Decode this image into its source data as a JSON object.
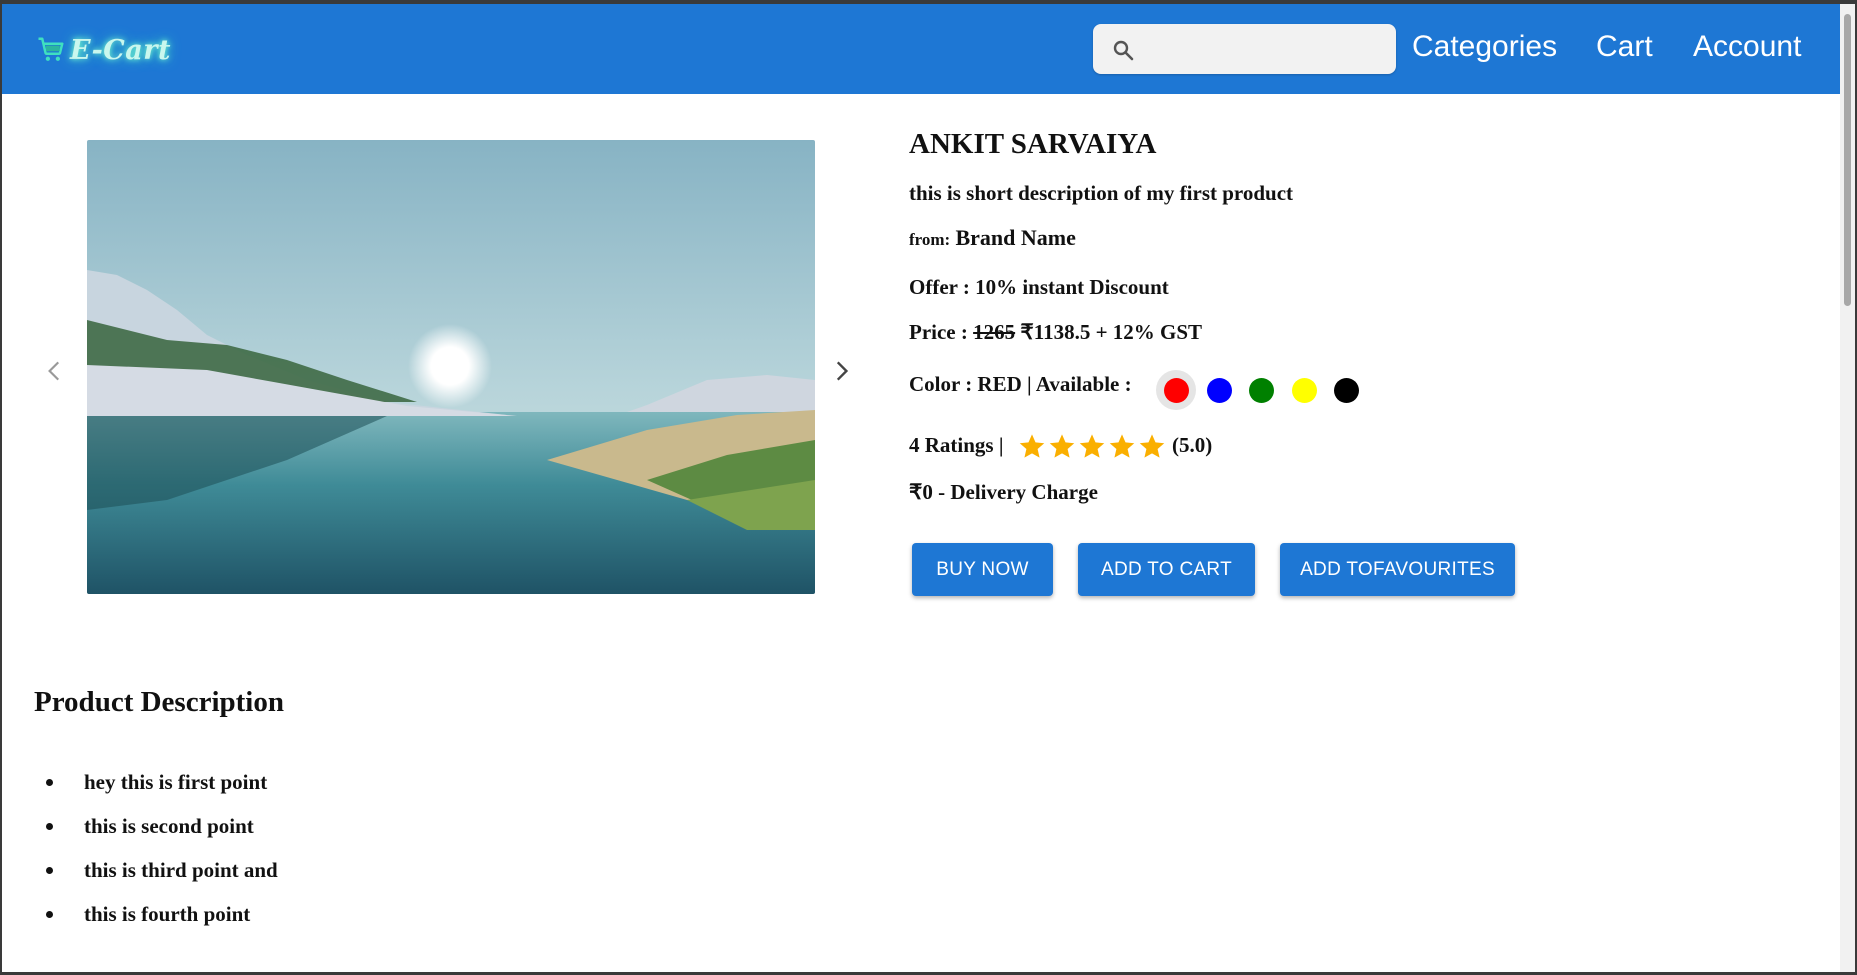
{
  "header": {
    "logo_text": "E-Cart",
    "search": {
      "value": "",
      "placeholder": ""
    },
    "nav": {
      "categories": "Categories",
      "cart": "Cart",
      "account": "Account"
    }
  },
  "product": {
    "name": "ANKIT SARVAIYA",
    "short_description": "this is short description of my first product",
    "from_label": "from:",
    "brand": "Brand Name",
    "offer": "Offer : 10% instant Discount",
    "price_label": "Price :",
    "original_price": "1265",
    "discounted_price": "₹1138.5",
    "tax": "+ 12% GST",
    "color_label": "Color : RED | Available :",
    "colors": [
      "#ff0000",
      "#0000ff",
      "#008000",
      "#ffff00",
      "#000000"
    ],
    "selected_color_index": 0,
    "ratings_label": "4 Ratings |",
    "rating_value": 5,
    "rating_text": "(5.0)",
    "delivery": "₹0 - Delivery Charge",
    "star_color": "#faaf00"
  },
  "actions": {
    "buy_now": "BUY NOW",
    "add_to_cart": "ADD TO CART",
    "add_to_favourites": "ADD TOFAVOURITES"
  },
  "description": {
    "title": "Product Description",
    "points": [
      "hey this is first point",
      "this is second point",
      "this is third point and",
      "this is fourth point"
    ]
  },
  "icons": {
    "logo": "shopping-cart-icon",
    "search": "search-icon",
    "prev": "chevron-left-icon",
    "next": "chevron-right-icon",
    "star": "star-icon"
  },
  "colors": {
    "brand": "#1e77d4",
    "button": "#1e77d4"
  }
}
